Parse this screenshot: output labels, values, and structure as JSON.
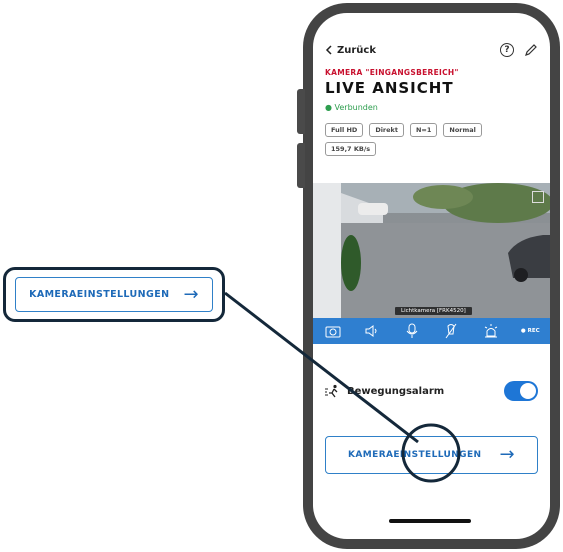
{
  "callout": {
    "label": "KAMERAEINSTELLUNGEN",
    "arrow": "→"
  },
  "nav": {
    "back_label": "Zurück",
    "help_icon": "?",
    "icons": [
      "chevron-left-icon",
      "help-icon",
      "pencil-icon"
    ]
  },
  "camera_page": {
    "eyebrow": "KAMERA \"EINGANGSBEREICH\"",
    "title": "LIVE ANSICHT",
    "status": "● Verbunden",
    "chips": [
      "Full HD",
      "Direkt",
      "N=1",
      "Normal",
      "159,7 KB/s"
    ],
    "camera_label": "Lichtkamera [FRK4520]"
  },
  "controls": {
    "items": [
      "camera-snapshot-icon",
      "speaker-icon",
      "microphone-icon",
      "light-off-icon",
      "siren-icon"
    ],
    "rec_label": "● REC"
  },
  "motion": {
    "label": "Bewegungsalarm",
    "enabled": true
  },
  "settings_button": {
    "label": "KAMERAEINSTELLUNGEN",
    "arrow": "→"
  },
  "colors": {
    "accent": "#2f80c8",
    "brand_red": "#c8102e",
    "connected": "#2e9e4f",
    "control_bar": "#2f7fd0",
    "dark": "#14283a"
  }
}
